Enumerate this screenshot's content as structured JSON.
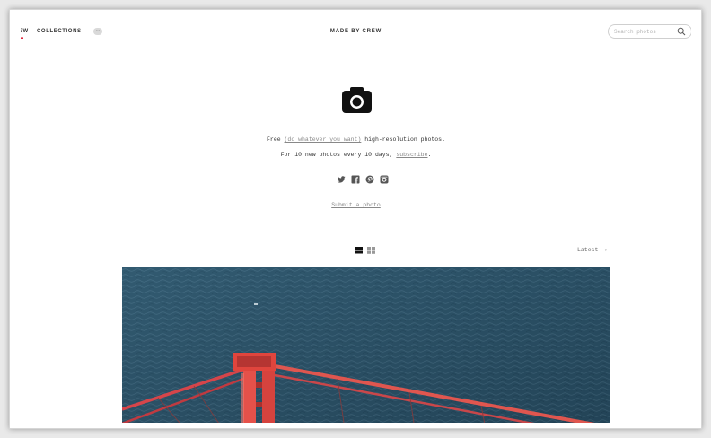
{
  "nav": {
    "new_label": "EW",
    "collections_label": "COLLECTIONS",
    "more_label": "···",
    "brand": "MADE BY CREW",
    "search_placeholder": "Search photos"
  },
  "hero": {
    "line1_prefix": "Free ",
    "line1_link": "(do whatever you want)",
    "line1_suffix": " high-resolution photos.",
    "line2_prefix": "For 10 new photos every 10 days, ",
    "line2_link": "subscribe",
    "line2_suffix": ".",
    "submit_label": "Submit a photo",
    "social_icons": [
      "twitter-icon",
      "facebook-icon",
      "pinterest-icon",
      "instagram-icon"
    ]
  },
  "toolbar": {
    "sort_label": "Latest",
    "sort_caret": "▾"
  },
  "colors": {
    "accent": "#e0243c",
    "ocean": "#2c5066",
    "bridge": "#e0453d"
  }
}
